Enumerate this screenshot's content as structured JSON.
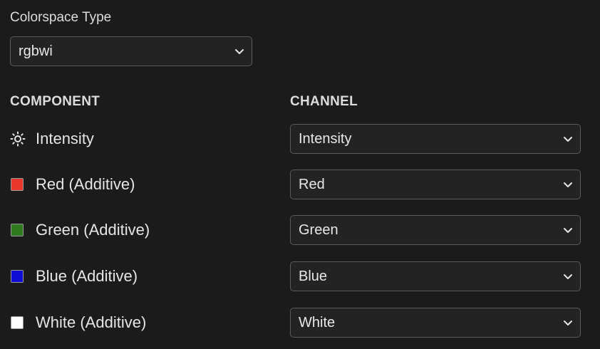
{
  "colorspace": {
    "label": "Colorspace Type",
    "value": "rgbwi"
  },
  "headers": {
    "component": "COMPONENT",
    "channel": "CHANNEL"
  },
  "rows": [
    {
      "component": "Intensity",
      "icon": "sun-icon",
      "channel": "Intensity"
    },
    {
      "component": "Red (Additive)",
      "color": "#e8382b",
      "channel": "Red"
    },
    {
      "component": "Green (Additive)",
      "color": "#2f7a1f",
      "channel": "Green"
    },
    {
      "component": "Blue (Additive)",
      "color": "#0d0dd6",
      "channel": "Blue"
    },
    {
      "component": "White (Additive)",
      "color": "#ffffff",
      "channel": "White"
    }
  ]
}
